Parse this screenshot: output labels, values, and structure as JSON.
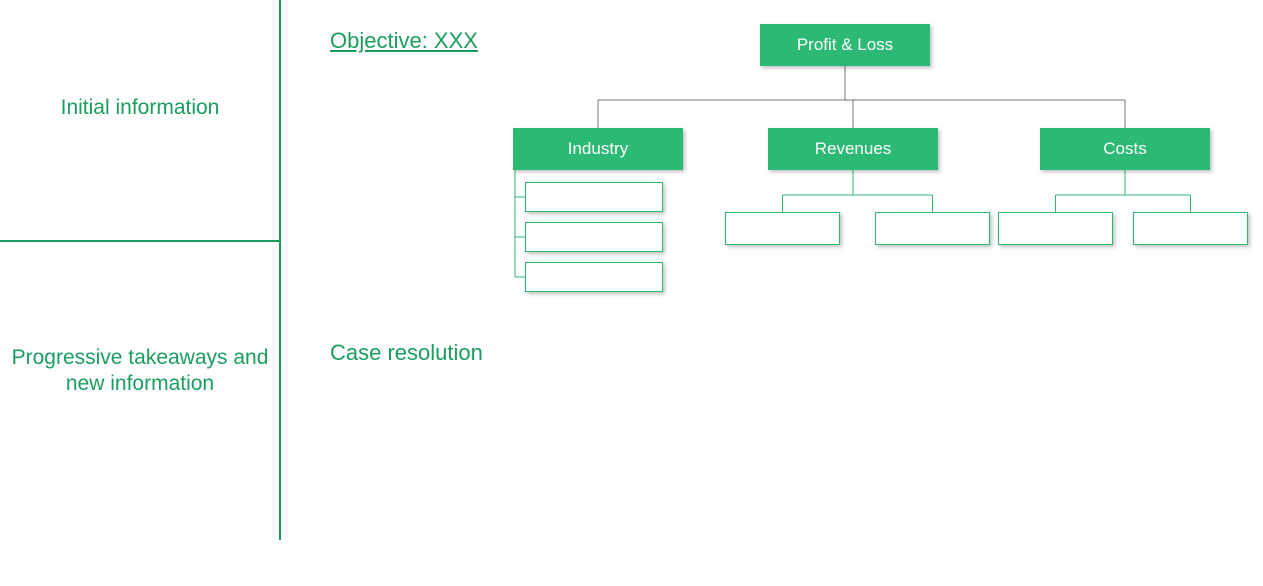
{
  "sidebar": {
    "top_label": "Initial information",
    "bottom_label": "Progressive takeaways and new information"
  },
  "main": {
    "objective_label": "Objective: XXX",
    "case_resolution_label": "Case resolution"
  },
  "tree": {
    "root": {
      "label": "Profit & Loss"
    },
    "level2": {
      "industry": {
        "label": "Industry"
      },
      "revenues": {
        "label": "Revenues"
      },
      "costs": {
        "label": "Costs"
      }
    },
    "industry_children": {
      "a": "",
      "b": "",
      "c": ""
    },
    "revenues_children": {
      "a": "",
      "b": ""
    },
    "costs_children": {
      "a": "",
      "b": ""
    }
  },
  "colors": {
    "primary": "#1a9e5e",
    "node_fill": "#2cb973"
  }
}
